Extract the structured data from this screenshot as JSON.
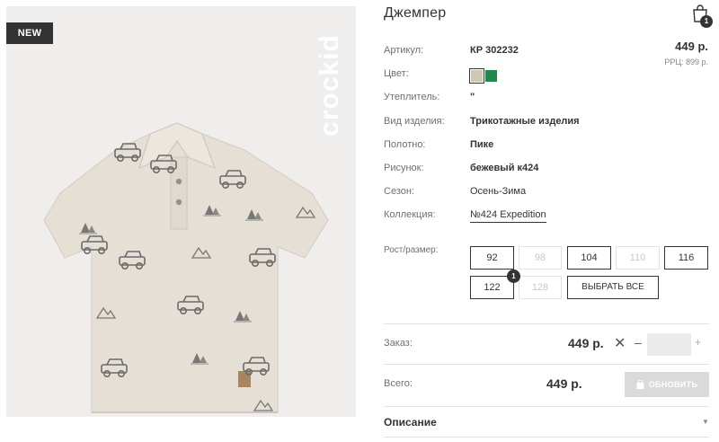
{
  "image": {
    "badge": "NEW",
    "brand_logo": "crockid"
  },
  "product": {
    "title": "Джемпер",
    "price": "449 р.",
    "rrp": "РРЦ: 899 р."
  },
  "cart": {
    "icon": "shopping-bag-icon",
    "count": "1"
  },
  "specs": [
    {
      "label": "Артикул:",
      "value": "КР 302232"
    },
    {
      "label": "Цвет:",
      "value": ""
    },
    {
      "label": "Утеплитель:",
      "value": "\""
    },
    {
      "label": "Вид изделия:",
      "value": "Трикотажные изделия"
    },
    {
      "label": "Полотно:",
      "value": "Пике"
    },
    {
      "label": "Рисунок:",
      "value": "бежевый к424"
    },
    {
      "label": "Сезон:",
      "value": "Осень-Зима"
    },
    {
      "label": "Коллекция:",
      "value": "№424 Expedition"
    }
  ],
  "colors": [
    {
      "name": "beige",
      "hex": "#cfc6b3",
      "selected": true
    },
    {
      "name": "green",
      "hex": "#21894f",
      "selected": false
    }
  ],
  "sizes": {
    "label": "Рост/размер:",
    "items": [
      "92",
      "98",
      "104",
      "110",
      "116",
      "122",
      "128"
    ],
    "available": [
      "92",
      "104",
      "116",
      "122"
    ],
    "selected_count_badge": "1",
    "select_all": "ВЫБРАТЬ ВСЕ"
  },
  "order": {
    "label": "Заказ:",
    "price": "449 р.",
    "remove": "✕",
    "minus": "–",
    "plus": "+",
    "quantity": ""
  },
  "total": {
    "label": "Всего:",
    "price": "449 р.",
    "update_button": "ОБНОВИТЬ"
  },
  "description": {
    "label": "Описание"
  }
}
